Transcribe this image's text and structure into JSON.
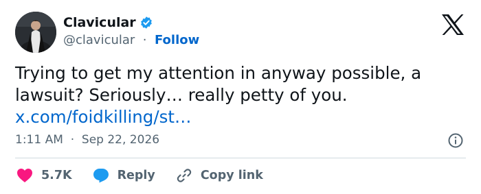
{
  "author": {
    "name": "Clavicular",
    "handle": "@clavicular",
    "separator": "·",
    "follow_label": "Follow",
    "verified_icon": "verified-badge-icon",
    "avatar": "profile-photo"
  },
  "brand_icon": "x-logo-icon",
  "tweet": {
    "lines": [
      "Trying to get my attention in anyway possible, a",
      "lawsuit? Seriously… really petty of you."
    ],
    "link": "x.com/foidkilling/st…"
  },
  "meta": {
    "time": "1:11 AM",
    "separator": "·",
    "date": "Sep 22, 2026",
    "info_icon": "info-icon"
  },
  "actions": {
    "like_count": "5.7K",
    "reply_label": "Reply",
    "copy_link_label": "Copy link"
  },
  "colors": {
    "link": "#0066cc",
    "like": "#f91880",
    "reply": "#1d9bf0",
    "verified": "#1d9bf0",
    "secondary_text": "#536471"
  }
}
